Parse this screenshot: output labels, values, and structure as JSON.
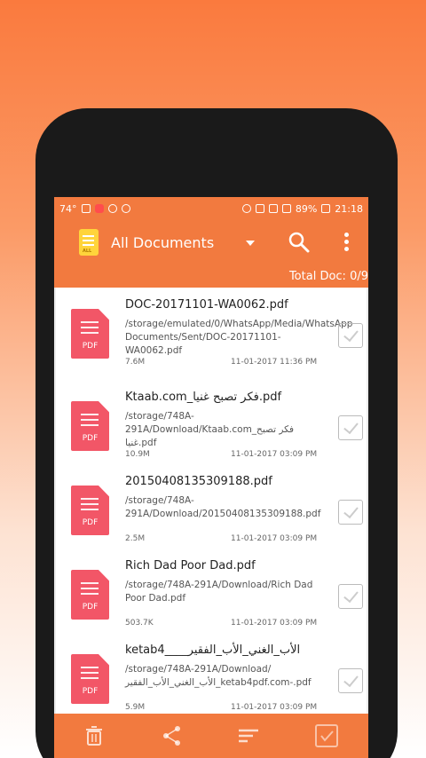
{
  "status_bar": {
    "temperature": "74°",
    "battery": "89%",
    "time": "21:18"
  },
  "app_bar": {
    "logo_text": "ALL",
    "title": "All Documents",
    "total_docs": "Total Doc: 0/9"
  },
  "documents": [
    {
      "name": "DOC-20171101-WA0062.pdf",
      "path": "/storage/emulated/0/WhatsApp/Media/WhatsApp Documents/Sent/DOC-20171101-WA0062.pdf",
      "size": "7.6M",
      "date": "11-01-2017 11:36 PM"
    },
    {
      "name": "Ktaab.com_فكر تصبح غنيا.pdf",
      "path": "/storage/748A-291A/Download/Ktaab.com_فكر تصبح غنيا.pdf",
      "size": "10.9M",
      "date": "11-01-2017 03:09 PM"
    },
    {
      "name": "20150408135309188.pdf",
      "path": "/storage/748A-291A/Download/20150408135309188.pdf",
      "size": "2.5M",
      "date": "11-01-2017 03:09 PM"
    },
    {
      "name": "Rich Dad Poor Dad.pdf",
      "path": "/storage/748A-291A/Download/Rich Dad Poor Dad.pdf",
      "size": "503.7K",
      "date": "11-01-2017 03:09 PM"
    },
    {
      "name": "ketab4____الأب_الغني_الأب_الفقير",
      "path": "/storage/748A-291A/Download/الأب_الغني_الأب_الفقير_ketab4pdf.com-.pdf",
      "size": "5.9M",
      "date": "11-01-2017 03:09 PM"
    }
  ],
  "pdf_label": "PDF",
  "colors": {
    "primary": "#f27a3f",
    "pdf_icon": "#f25667"
  },
  "bottom_bar": {
    "icons": [
      "delete-icon",
      "share-icon",
      "sort-icon",
      "select-all-icon"
    ]
  }
}
